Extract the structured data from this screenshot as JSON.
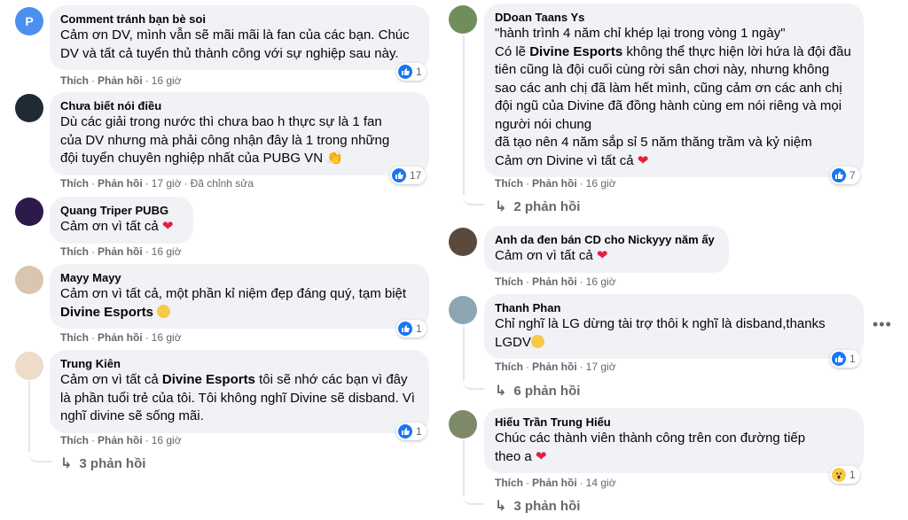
{
  "left": [
    {
      "name": "Comment tránh bạn bè soi",
      "avatar_letter": "P",
      "text_html": "Cảm ơn DV, mình vẫn sẽ mãi mãi là fan của các bạn. Chúc DV và tất cả tuyển thủ thành công với sự nghiệp sau này.",
      "reactions": "1",
      "like": "Thích",
      "reply": "Phản hồi",
      "time": "16 giờ"
    },
    {
      "name": "Chưa biết nói điều",
      "text": "Dù các giải trong nước thì chưa bao h thực sự là 1 fan của DV nhưng mà phải công nhận đây là 1 trong những đội tuyển chuyên nghiệp nhất của PUBG VN 👏",
      "reactions": "17",
      "like": "Thích",
      "reply": "Phản hồi",
      "time": "17 giờ",
      "edited": "Đã chỉnh sửa"
    },
    {
      "name": "Quang Triper PUBG",
      "text": "Cảm ơn vì tất cả",
      "reactions": "",
      "like": "Thích",
      "reply": "Phản hồi",
      "time": "16 giờ"
    },
    {
      "name": "Mayy Mayy",
      "text_pre": "Cảm ơn vì tất cả, một phần kỉ niệm đẹp đáng quý, tạm biệt ",
      "text_bold": "Divine Esports",
      "reactions": "1",
      "like": "Thích",
      "reply": "Phản hồi",
      "time": "16 giờ"
    },
    {
      "name": "Trung Kiên",
      "text_pre": "Cảm ơn vì tất cả ",
      "text_bold": "Divine Esports",
      "text_post": " tôi sẽ nhớ các bạn vì đây là phần tuổi trẻ của tôi. Tôi không nghĩ Divine sẽ disband. Vì nghĩ divine sẽ sống mãi.",
      "reactions": "1",
      "like": "Thích",
      "reply": "Phản hồi",
      "time": "16 giờ",
      "replies": "3 phản hồi"
    }
  ],
  "right": [
    {
      "name": "DDoan Taans Ys",
      "text_l1": "\"hành trình 4 năm chỉ khép lại trong vòng 1 ngày\"",
      "text_l2_pre": "Có lẽ ",
      "text_l2_bold": "Divine Esports",
      "text_l2_post": " không thể thực hiện lời hứa là đội đầu tiên cũng là đội cuối cùng rời sân chơi này, nhưng không sao các anh chị đã làm hết mình, cũng cảm ơn các anh chị đội ngũ của Divine đã đồng hành cùng em nói riêng và mọi người nói chung",
      "text_l3": "đã tạo nên 4 năm sắp sỉ 5 năm thăng trầm và kỷ niệm",
      "text_l4": "Cảm ơn Divine vì tất cả",
      "reactions": "7",
      "like": "Thích",
      "reply": "Phản hồi",
      "time": "16 giờ",
      "replies": "2 phản hồi"
    },
    {
      "name": "Anh da đen bán CD cho Nickyyy năm ấy",
      "text": "Cảm ơn vì tất cả",
      "like": "Thích",
      "reply": "Phản hồi",
      "time": "16 giờ"
    },
    {
      "name": "Thanh Phan",
      "text": "Chỉ nghĩ là LG dừng tài trợ thôi k nghĩ là disband,thanks LGDV",
      "reactions": "1",
      "like": "Thích",
      "reply": "Phản hồi",
      "time": "17 giờ",
      "replies": "6 phản hồi",
      "more": "•••"
    },
    {
      "name": "Hiếu Trần Trung Hiếu",
      "text": "Chúc các thành viên thành công trên con đường tiếp theo a",
      "reactions": "1",
      "like": "Thích",
      "reply": "Phản hồi",
      "time": "14 giờ",
      "replies": "3 phản hồi"
    }
  ],
  "colors": {
    "bubble": "#f0f2f5",
    "secondary": "#65676b",
    "like_blue": "#1877f2",
    "heart": "#e41e3f"
  }
}
